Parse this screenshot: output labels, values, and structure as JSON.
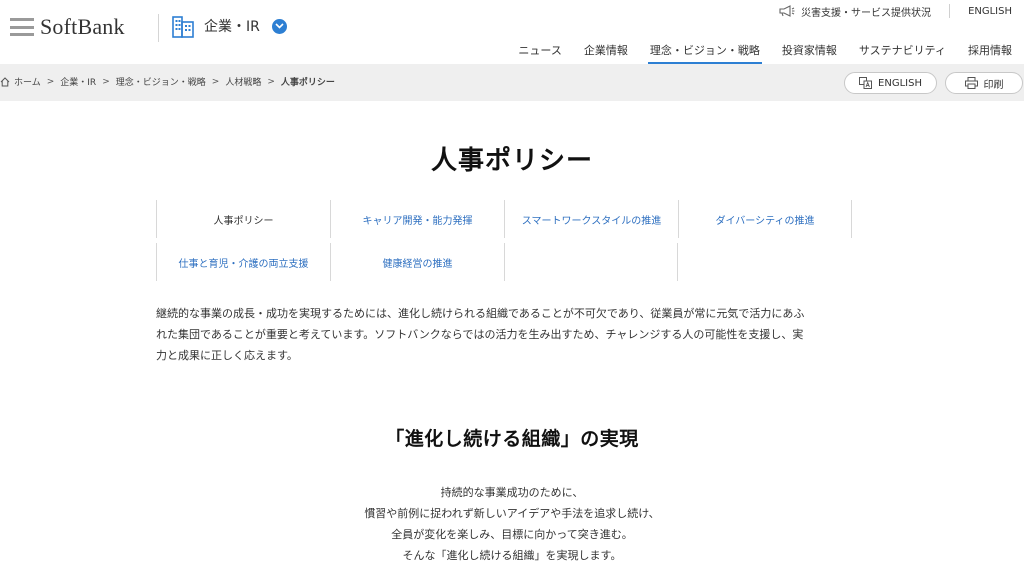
{
  "header": {
    "logo_text": "SoftBank",
    "corp_selector_label": "企業・IR",
    "util_links": {
      "disaster": "災害支援・サービス提供状況",
      "english": "ENGLISH"
    },
    "gnav": [
      {
        "label": "ニュース",
        "active": false
      },
      {
        "label": "企業情報",
        "active": false
      },
      {
        "label": "理念・ビジョン・戦略",
        "active": true
      },
      {
        "label": "投資家情報",
        "active": false
      },
      {
        "label": "サステナビリティ",
        "active": false
      },
      {
        "label": "採用情報",
        "active": false
      }
    ]
  },
  "breadcrumb": {
    "items": [
      "ホーム",
      "企業・IR",
      "理念・ビジョン・戦略",
      "人材戦略",
      "人事ポリシー"
    ],
    "separator": ">"
  },
  "buttons": {
    "english": "ENGLISH",
    "print": "印刷"
  },
  "main": {
    "title": "人事ポリシー",
    "subnav": [
      [
        "人事ポリシー",
        "キャリア開発・能力発揮",
        "スマートワークスタイルの推進",
        "ダイバーシティの推進"
      ],
      [
        "仕事と育児・介護の両立支援",
        "健康経営の推進"
      ]
    ],
    "subnav_current": "人事ポリシー",
    "intro_lines": [
      "継続的な事業の成長・成功を実現するためには、進化し続けられる組織であることが不可欠であり、従業員が常に元気で活力にあふ",
      "れた集団であることが重要と考えています。ソフトバンクならではの活力を生み出すため、チャレンジする人の可能性を支援し、実",
      "力と成果に正しく応えます。"
    ],
    "section_title": "「進化し続ける組織」の実現",
    "poem_lines": [
      "持続的な事業成功のために、",
      "慣習や前例に捉われず新しいアイデアや手法を追求し続け、",
      "全員が変化を楽しみ、目標に向かって突き進む。",
      "そんな「進化し続ける組織」を実現します。"
    ]
  },
  "colors": {
    "accent": "#2d7fd3",
    "link": "#2d6fc0",
    "breadcrumb_bg": "#efefef"
  },
  "icons": [
    "logo-bars-icon",
    "building-icon",
    "chevron-down-icon",
    "megaphone-icon",
    "home-icon",
    "english-icon",
    "print-icon"
  ]
}
